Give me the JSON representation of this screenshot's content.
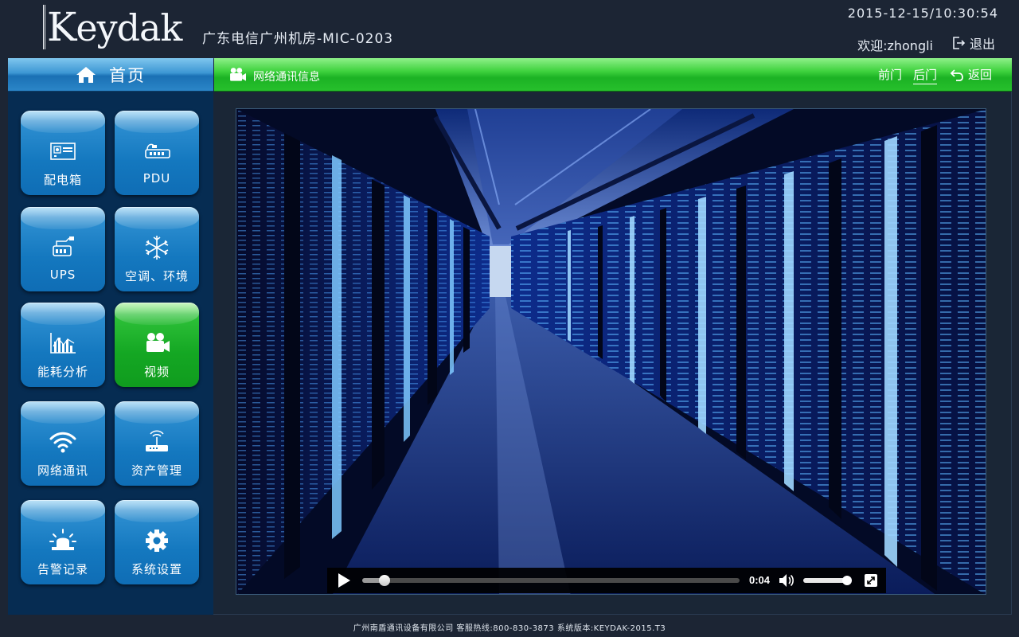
{
  "header": {
    "logo": "Keydak",
    "logo_k": "K",
    "logo_rest": "eydak",
    "site_title": "广东电信广州机房-MIC-0203",
    "datetime": "2015-12-15/10:30:54",
    "welcome": "欢迎:zhongli",
    "logout_label": "退出"
  },
  "sidebar": {
    "home_label": "首页",
    "tiles": [
      {
        "label": "配电箱",
        "icon": "distribution-box-icon",
        "active": false
      },
      {
        "label": "PDU",
        "icon": "pdu-icon",
        "active": false
      },
      {
        "label": "UPS",
        "icon": "ups-icon",
        "active": false
      },
      {
        "label": "空调、环境",
        "icon": "snowflake-icon",
        "active": false
      },
      {
        "label": "能耗分析",
        "icon": "bar-chart-icon",
        "active": false
      },
      {
        "label": "视频",
        "icon": "video-camera-icon",
        "active": true
      },
      {
        "label": "网络通讯",
        "icon": "wifi-icon",
        "active": false
      },
      {
        "label": "资产管理",
        "icon": "router-icon",
        "active": false
      },
      {
        "label": "告警记录",
        "icon": "alarm-icon",
        "active": false
      },
      {
        "label": "系统设置",
        "icon": "gear-icon",
        "active": false
      }
    ]
  },
  "content": {
    "title": "网络通讯信息",
    "front_door": "前门",
    "rear_door": "后门",
    "back_label": "返回",
    "selected_door": "后门"
  },
  "player": {
    "current_time": "0:04",
    "progress": 0.06,
    "volume": 0.92
  },
  "footer": {
    "text": "广州南盾通讯设备有限公司 客服热线:800-830-3873 系统版本:KEYDAK-2015.T3"
  },
  "colors": {
    "background": "#1c2534",
    "sidebar": "#062c52",
    "tile_blue": "#1478bf",
    "tile_active": "#14a723",
    "title_bar_green": "#1bb224",
    "home_bar_blue": "#2b86c8"
  }
}
